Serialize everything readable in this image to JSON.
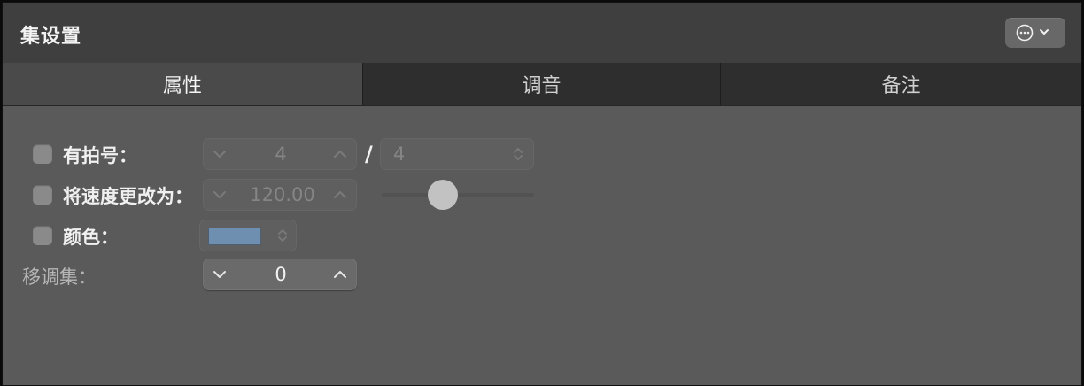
{
  "window": {
    "title": "集设置",
    "menu_icon": "ellipsis-circle-icon",
    "menu_chevron": "chevron-down-icon"
  },
  "tabs": [
    {
      "label": "属性",
      "active": true
    },
    {
      "label": "调音",
      "active": false
    },
    {
      "label": "备注",
      "active": false
    }
  ],
  "properties": {
    "time_signature": {
      "label": "有拍号：",
      "checked": false,
      "numerator": "4",
      "separator": "/",
      "denominator": "4"
    },
    "tempo": {
      "label": "将速度更改为：",
      "checked": false,
      "value": "120.00"
    },
    "color": {
      "label": "颜色：",
      "checked": false,
      "swatch_color": "#6f8fb0"
    },
    "transpose": {
      "label": "移调集：",
      "value": "0"
    }
  },
  "colors": {
    "background": "#5a5a5a",
    "header": "#3f3f3f",
    "tab_inactive": "#2e2e2e",
    "tab_active": "#4a4a4a"
  }
}
